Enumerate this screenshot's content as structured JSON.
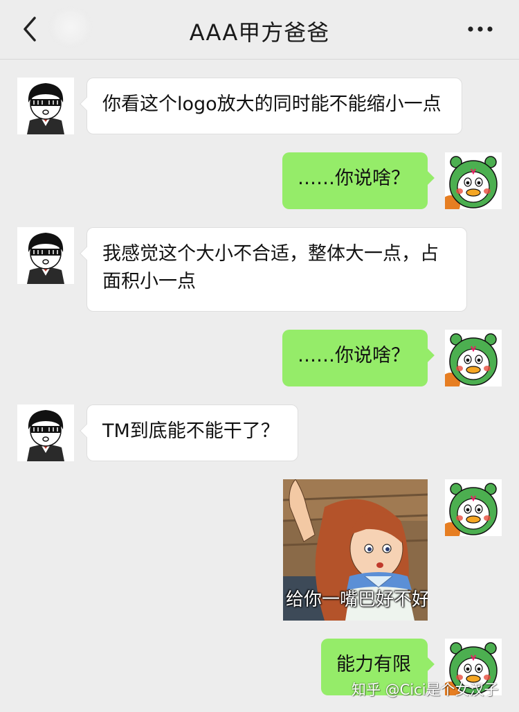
{
  "header": {
    "title": "AAA甲方爸爸",
    "back_icon": "chevron-left-icon",
    "more_icon": "more-dots-icon"
  },
  "messages": [
    {
      "side": "left",
      "text": "你看这个logo放大的同时能不能缩小一点"
    },
    {
      "side": "right",
      "text": "……你说啥？"
    },
    {
      "side": "left",
      "text": "我感觉这个大小不合适，整体大一点，占面积小一点"
    },
    {
      "side": "right",
      "text": "……你说啥？"
    },
    {
      "side": "left",
      "text": "TM到底能不能干了？"
    },
    {
      "side": "right",
      "type": "sticker",
      "caption": "给你一嘴巴好不好"
    },
    {
      "side": "right",
      "text": "能力有限"
    }
  ],
  "watermark": "知乎 @Cici是个女汉子",
  "colors": {
    "background": "#ededed",
    "my_bubble": "#95ec69",
    "their_bubble": "#ffffff"
  }
}
